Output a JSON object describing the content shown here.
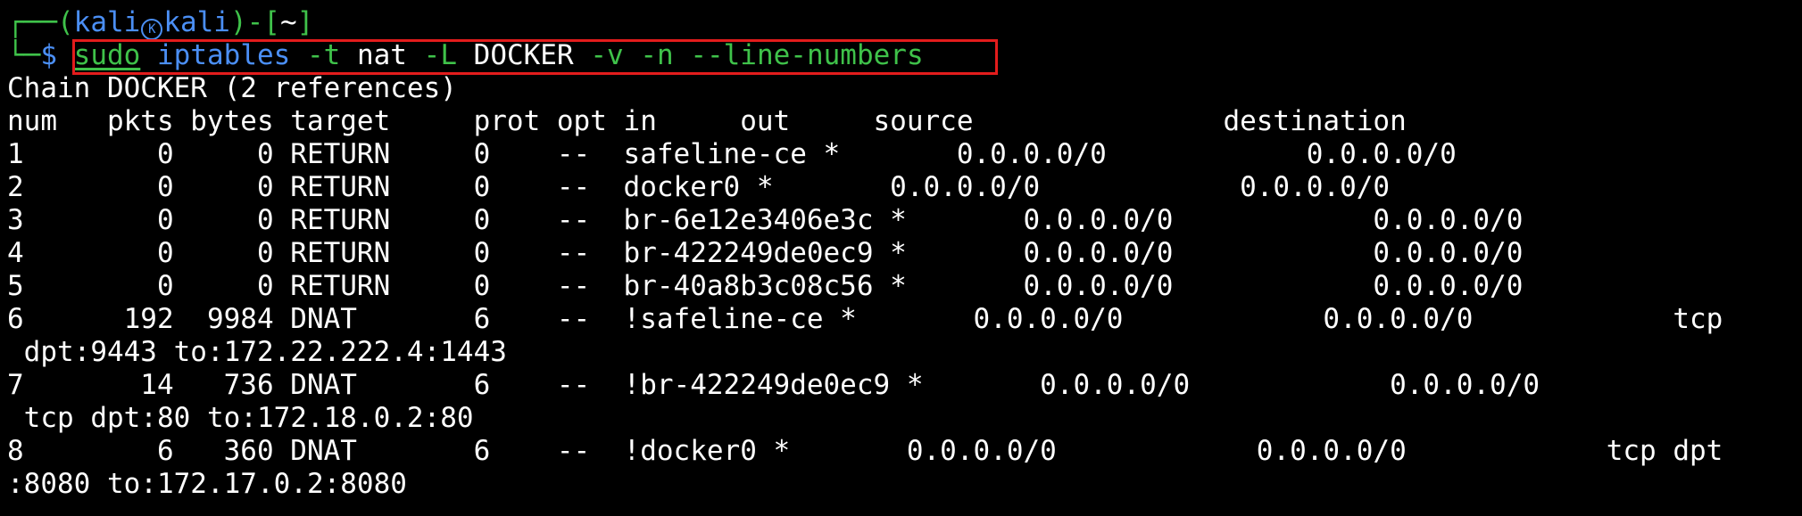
{
  "prompt": {
    "corner_top": "┌──(",
    "user": "kali",
    "logo_glyph": "K",
    "host": "kali",
    "mid": ")-[",
    "cwd": "~",
    "end": "]",
    "corner_bottom": "└─",
    "symbol": "$"
  },
  "command": {
    "sudo": "sudo",
    "program": "iptables",
    "flag_t": "-t",
    "table": "nat",
    "flag_L": "-L",
    "chain": "DOCKER",
    "flag_v": "-v",
    "flag_n": "-n",
    "flag_line_numbers": "--line-numbers"
  },
  "output": {
    "chain_header": "Chain DOCKER (2 references)",
    "column_header": "num   pkts bytes target     prot opt in     out     source               destination",
    "rows": [
      "1        0     0 RETURN     0    --  safeline-ce *       0.0.0.0/0            0.0.0.0/0",
      "2        0     0 RETURN     0    --  docker0 *       0.0.0.0/0            0.0.0.0/0",
      "3        0     0 RETURN     0    --  br-6e12e3406e3c *       0.0.0.0/0            0.0.0.0/0",
      "4        0     0 RETURN     0    --  br-422249de0ec9 *       0.0.0.0/0            0.0.0.0/0",
      "5        0     0 RETURN     0    --  br-40a8b3c08c56 *       0.0.0.0/0            0.0.0.0/0",
      "6      192  9984 DNAT       6    --  !safeline-ce *       0.0.0.0/0            0.0.0.0/0            tcp",
      " dpt:9443 to:172.22.222.4:1443",
      "7       14   736 DNAT       6    --  !br-422249de0ec9 *       0.0.0.0/0            0.0.0.0/0",
      " tcp dpt:80 to:172.18.0.2:80",
      "8        6   360 DNAT       6    --  !docker0 *       0.0.0.0/0            0.0.0.0/0            tcp dpt",
      ":8080 to:172.17.0.2:8080"
    ]
  },
  "colors": {
    "background": "#000000",
    "prompt_green": "#3fc24a",
    "prompt_blue": "#4b8ff5",
    "highlight_red": "#e31c1c",
    "text": "#ffffff"
  }
}
